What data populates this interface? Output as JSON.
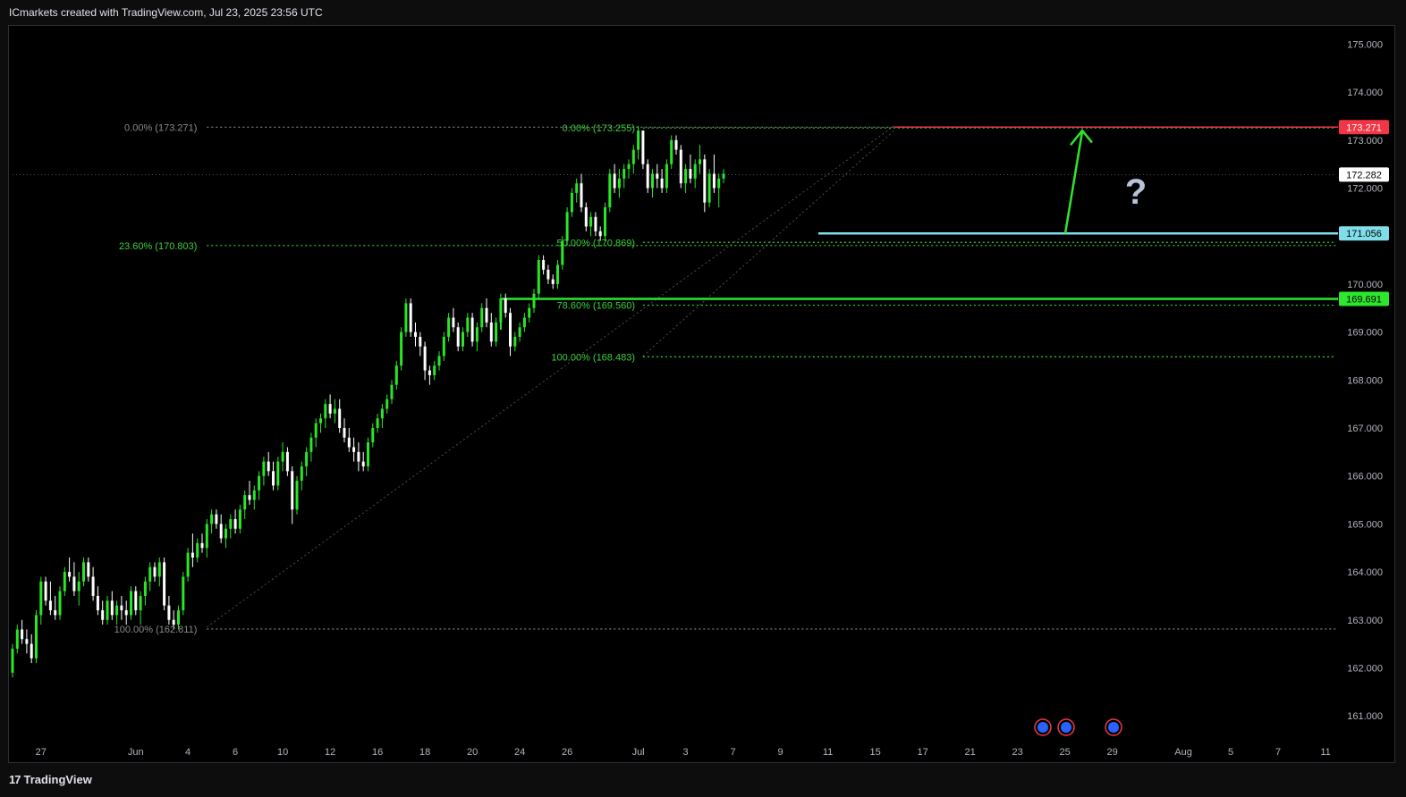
{
  "header": {
    "attribution": "ICmarkets created with TradingView.com, Jul 23, 2025 23:56 UTC"
  },
  "footer": {
    "brand": "TradingView",
    "brand_mark": "17"
  },
  "colors": {
    "background": "#000000",
    "up": "#29e627",
    "down": "#ffffff",
    "fib": "#3bd13b",
    "resistance": "#f23645",
    "support": "#80deea",
    "level": "#2ee62e",
    "arrow": "#2ee62e",
    "question": "#b7c3d6"
  },
  "chart_data": {
    "type": "candlestick",
    "ylim": [
      160.5,
      175.4
    ],
    "y_ticks": [
      "175.000",
      "174.000",
      "173.000",
      "172.000",
      "171.000",
      "170.000",
      "169.000",
      "168.000",
      "167.000",
      "166.000",
      "165.000",
      "164.000",
      "163.000",
      "162.000",
      "161.000"
    ],
    "x_ticks": [
      {
        "label": "27",
        "bar": 6
      },
      {
        "label": "Jun",
        "bar": 26
      },
      {
        "label": "4",
        "bar": 37
      },
      {
        "label": "6",
        "bar": 47
      },
      {
        "label": "10",
        "bar": 57
      },
      {
        "label": "12",
        "bar": 67
      },
      {
        "label": "16",
        "bar": 77
      },
      {
        "label": "18",
        "bar": 87
      },
      {
        "label": "20",
        "bar": 97
      },
      {
        "label": "24",
        "bar": 107
      },
      {
        "label": "26",
        "bar": 117
      },
      {
        "label": "Jul",
        "bar": 132
      },
      {
        "label": "3",
        "bar": 142
      },
      {
        "label": "7",
        "bar": 152
      },
      {
        "label": "9",
        "bar": 162
      },
      {
        "label": "11",
        "bar": 172
      },
      {
        "label": "15",
        "bar": 182
      },
      {
        "label": "17",
        "bar": 192
      },
      {
        "label": "21",
        "bar": 202
      },
      {
        "label": "23",
        "bar": 212
      },
      {
        "label": "25",
        "bar": 222
      },
      {
        "label": "29",
        "bar": 232
      },
      {
        "label": "Aug",
        "bar": 247
      },
      {
        "label": "5",
        "bar": 257
      },
      {
        "label": "7",
        "bar": 267
      },
      {
        "label": "11",
        "bar": 277
      }
    ],
    "price_labels": [
      {
        "value": "173.271",
        "price": 173.271,
        "kind": "resistance"
      },
      {
        "value": "172.282",
        "price": 172.282,
        "kind": "current"
      },
      {
        "value": "171.056",
        "price": 171.056,
        "kind": "support"
      },
      {
        "value": "169.691",
        "price": 169.691,
        "kind": "level"
      }
    ],
    "fib_labels": [
      {
        "text": "0.00% (173.271)",
        "price": 173.271,
        "bar": 38,
        "muted": true
      },
      {
        "text": "23.60% (170.803)",
        "price": 170.803,
        "bar": 38,
        "muted": false
      },
      {
        "text": "100.00% (162.811)",
        "price": 162.811,
        "bar": 38,
        "muted": true
      },
      {
        "text": "0.00% (173.255)",
        "price": 173.255,
        "bar": 130,
        "muted": false
      },
      {
        "text": "50.00% (170.869)",
        "price": 170.869,
        "bar": 130,
        "muted": false
      },
      {
        "text": "78.60% (169.560)",
        "price": 169.56,
        "bar": 130,
        "muted": false
      },
      {
        "text": "100.00% (168.483)",
        "price": 168.483,
        "bar": 130,
        "muted": false
      }
    ],
    "annotation": "?",
    "candles": [
      [
        161.9,
        162.5,
        161.8,
        162.4
      ],
      [
        162.4,
        162.9,
        162.3,
        162.8
      ],
      [
        162.8,
        163.0,
        162.5,
        162.6
      ],
      [
        162.6,
        162.8,
        162.3,
        162.5
      ],
      [
        162.5,
        162.7,
        162.1,
        162.2
      ],
      [
        162.2,
        163.2,
        162.1,
        163.1
      ],
      [
        163.1,
        163.9,
        162.9,
        163.8
      ],
      [
        163.8,
        163.9,
        163.3,
        163.4
      ],
      [
        163.4,
        163.8,
        163.1,
        163.2
      ],
      [
        163.2,
        163.5,
        163.0,
        163.1
      ],
      [
        163.1,
        163.7,
        163.0,
        163.6
      ],
      [
        163.6,
        164.1,
        163.5,
        164.0
      ],
      [
        164.0,
        164.3,
        163.8,
        163.9
      ],
      [
        163.9,
        164.2,
        163.5,
        163.6
      ],
      [
        163.6,
        164.0,
        163.3,
        163.8
      ],
      [
        163.8,
        164.3,
        163.7,
        164.2
      ],
      [
        164.2,
        164.3,
        163.8,
        163.9
      ],
      [
        163.9,
        164.1,
        163.4,
        163.5
      ],
      [
        163.5,
        163.7,
        163.1,
        163.2
      ],
      [
        163.2,
        163.4,
        162.9,
        163.0
      ],
      [
        163.0,
        163.5,
        162.9,
        163.4
      ],
      [
        163.4,
        163.6,
        163.0,
        163.1
      ],
      [
        163.1,
        163.4,
        162.9,
        163.3
      ],
      [
        163.3,
        163.5,
        163.0,
        163.2
      ],
      [
        163.2,
        163.4,
        162.9,
        163.1
      ],
      [
        163.1,
        163.7,
        163.0,
        163.6
      ],
      [
        163.6,
        163.7,
        163.1,
        163.2
      ],
      [
        163.2,
        163.6,
        162.9,
        163.5
      ],
      [
        163.5,
        163.9,
        163.3,
        163.8
      ],
      [
        163.8,
        164.2,
        163.6,
        164.1
      ],
      [
        164.1,
        164.2,
        163.8,
        163.9
      ],
      [
        163.9,
        164.3,
        163.7,
        164.2
      ],
      [
        164.2,
        164.3,
        163.2,
        163.3
      ],
      [
        163.3,
        163.5,
        162.9,
        163.0
      ],
      [
        163.0,
        163.2,
        162.8,
        162.9
      ],
      [
        162.9,
        163.3,
        162.8,
        163.2
      ],
      [
        163.2,
        164.0,
        163.1,
        163.9
      ],
      [
        163.9,
        164.5,
        163.8,
        164.4
      ],
      [
        164.4,
        164.8,
        164.1,
        164.3
      ],
      [
        164.3,
        164.7,
        164.2,
        164.6
      ],
      [
        164.6,
        164.8,
        164.4,
        164.5
      ],
      [
        164.5,
        165.1,
        164.3,
        165.0
      ],
      [
        165.0,
        165.3,
        164.8,
        165.2
      ],
      [
        165.2,
        165.3,
        164.9,
        165.0
      ],
      [
        165.0,
        165.2,
        164.6,
        164.7
      ],
      [
        164.7,
        165.0,
        164.5,
        164.9
      ],
      [
        164.9,
        165.2,
        164.7,
        165.1
      ],
      [
        165.1,
        165.3,
        164.8,
        164.9
      ],
      [
        164.9,
        165.4,
        164.8,
        165.3
      ],
      [
        165.3,
        165.7,
        165.1,
        165.6
      ],
      [
        165.6,
        165.9,
        165.4,
        165.5
      ],
      [
        165.5,
        165.8,
        165.3,
        165.7
      ],
      [
        165.7,
        166.1,
        165.5,
        166.0
      ],
      [
        166.0,
        166.4,
        165.8,
        166.3
      ],
      [
        166.3,
        166.5,
        166.0,
        166.1
      ],
      [
        166.1,
        166.3,
        165.7,
        165.8
      ],
      [
        165.8,
        166.4,
        165.7,
        166.3
      ],
      [
        166.3,
        166.7,
        166.1,
        166.5
      ],
      [
        166.5,
        166.6,
        166.0,
        166.1
      ],
      [
        166.1,
        166.2,
        165.0,
        165.3
      ],
      [
        165.3,
        166.0,
        165.2,
        165.9
      ],
      [
        165.9,
        166.3,
        165.7,
        166.2
      ],
      [
        166.2,
        166.6,
        166.0,
        166.5
      ],
      [
        166.5,
        166.9,
        166.3,
        166.8
      ],
      [
        166.8,
        167.2,
        166.6,
        167.1
      ],
      [
        167.1,
        167.3,
        166.9,
        167.2
      ],
      [
        167.2,
        167.6,
        167.0,
        167.5
      ],
      [
        167.5,
        167.7,
        167.2,
        167.3
      ],
      [
        167.3,
        167.6,
        167.1,
        167.4
      ],
      [
        167.4,
        167.6,
        166.9,
        167.0
      ],
      [
        167.0,
        167.2,
        166.7,
        166.8
      ],
      [
        166.8,
        167.0,
        166.5,
        166.6
      ],
      [
        166.6,
        166.8,
        166.3,
        166.5
      ],
      [
        166.5,
        166.7,
        166.1,
        166.3
      ],
      [
        166.3,
        166.5,
        166.1,
        166.2
      ],
      [
        166.2,
        166.8,
        166.1,
        166.7
      ],
      [
        166.7,
        167.1,
        166.6,
        167.0
      ],
      [
        167.0,
        167.3,
        166.9,
        167.2
      ],
      [
        167.2,
        167.5,
        167.0,
        167.4
      ],
      [
        167.4,
        167.7,
        167.3,
        167.6
      ],
      [
        167.6,
        168.0,
        167.5,
        167.9
      ],
      [
        167.9,
        168.4,
        167.8,
        168.3
      ],
      [
        168.3,
        169.1,
        168.2,
        169.0
      ],
      [
        169.0,
        169.7,
        168.9,
        169.6
      ],
      [
        169.6,
        169.7,
        168.9,
        169.0
      ],
      [
        169.0,
        169.2,
        168.7,
        168.9
      ],
      [
        168.9,
        169.0,
        168.5,
        168.7
      ],
      [
        168.7,
        168.8,
        168.0,
        168.2
      ],
      [
        168.2,
        168.3,
        167.9,
        168.1
      ],
      [
        168.1,
        168.4,
        168.0,
        168.3
      ],
      [
        168.3,
        168.6,
        168.2,
        168.5
      ],
      [
        168.5,
        169.0,
        168.4,
        168.9
      ],
      [
        168.9,
        169.4,
        168.8,
        169.3
      ],
      [
        169.3,
        169.5,
        169.0,
        169.1
      ],
      [
        169.1,
        169.2,
        168.6,
        168.7
      ],
      [
        168.7,
        169.1,
        168.6,
        169.0
      ],
      [
        169.0,
        169.4,
        168.9,
        169.3
      ],
      [
        169.3,
        169.4,
        168.7,
        168.8
      ],
      [
        168.8,
        169.2,
        168.6,
        169.1
      ],
      [
        169.1,
        169.6,
        169.0,
        169.5
      ],
      [
        169.5,
        169.7,
        169.1,
        169.2
      ],
      [
        169.2,
        169.4,
        168.7,
        168.8
      ],
      [
        168.8,
        169.3,
        168.7,
        169.2
      ],
      [
        169.2,
        169.8,
        169.1,
        169.7
      ],
      [
        169.7,
        169.8,
        169.3,
        169.4
      ],
      [
        169.4,
        169.5,
        168.5,
        168.7
      ],
      [
        168.7,
        169.0,
        168.6,
        168.9
      ],
      [
        168.9,
        169.2,
        168.8,
        169.1
      ],
      [
        169.1,
        169.4,
        169.0,
        169.3
      ],
      [
        169.3,
        169.6,
        169.2,
        169.5
      ],
      [
        169.5,
        169.9,
        169.4,
        169.8
      ],
      [
        169.8,
        170.6,
        169.7,
        170.5
      ],
      [
        170.5,
        170.6,
        170.2,
        170.3
      ],
      [
        170.3,
        170.4,
        170.0,
        170.1
      ],
      [
        170.1,
        170.2,
        169.9,
        170.0
      ],
      [
        170.0,
        170.5,
        169.9,
        170.4
      ],
      [
        170.4,
        171.0,
        170.3,
        170.9
      ],
      [
        170.9,
        171.6,
        170.8,
        171.5
      ],
      [
        171.5,
        172.0,
        171.4,
        171.9
      ],
      [
        171.9,
        172.2,
        171.7,
        172.1
      ],
      [
        172.1,
        172.3,
        171.5,
        171.6
      ],
      [
        171.6,
        171.7,
        171.1,
        171.2
      ],
      [
        171.2,
        171.5,
        171.0,
        171.4
      ],
      [
        171.4,
        171.5,
        171.0,
        171.1
      ],
      [
        171.1,
        171.2,
        170.9,
        171.0
      ],
      [
        171.0,
        171.7,
        170.9,
        171.6
      ],
      [
        171.6,
        172.4,
        171.5,
        172.3
      ],
      [
        172.3,
        172.5,
        171.9,
        172.0
      ],
      [
        172.0,
        172.4,
        171.8,
        172.2
      ],
      [
        172.2,
        172.5,
        172.0,
        172.4
      ],
      [
        172.4,
        172.6,
        172.2,
        172.5
      ],
      [
        172.5,
        172.9,
        172.3,
        172.8
      ],
      [
        172.8,
        173.3,
        172.6,
        173.2
      ],
      [
        173.2,
        173.2,
        172.4,
        172.5
      ],
      [
        172.5,
        172.6,
        171.9,
        172.0
      ],
      [
        172.0,
        172.4,
        171.8,
        172.3
      ],
      [
        172.3,
        172.5,
        172.0,
        172.2
      ],
      [
        172.2,
        172.4,
        171.9,
        172.0
      ],
      [
        172.0,
        172.6,
        171.9,
        172.5
      ],
      [
        172.5,
        173.1,
        172.4,
        173.0
      ],
      [
        173.0,
        173.1,
        172.7,
        172.8
      ],
      [
        172.8,
        172.9,
        172.0,
        172.1
      ],
      [
        172.1,
        172.5,
        171.9,
        172.4
      ],
      [
        172.4,
        172.7,
        172.1,
        172.2
      ],
      [
        172.2,
        172.6,
        172.0,
        172.5
      ],
      [
        172.5,
        172.9,
        172.3,
        172.6
      ],
      [
        172.6,
        172.7,
        171.5,
        171.7
      ],
      [
        171.7,
        172.4,
        171.6,
        172.3
      ],
      [
        172.3,
        172.7,
        171.9,
        172.0
      ],
      [
        172.0,
        172.3,
        171.6,
        172.2
      ],
      [
        172.2,
        172.4,
        172.1,
        172.3
      ]
    ]
  }
}
